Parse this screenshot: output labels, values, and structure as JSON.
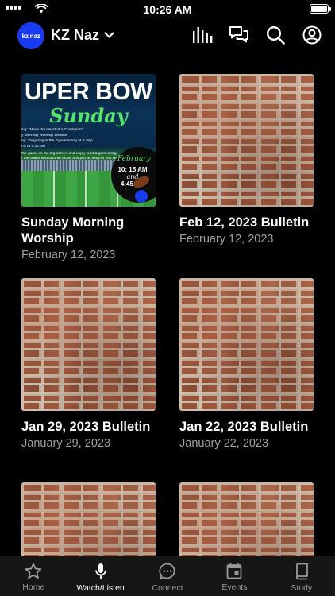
{
  "status": {
    "time": "10:26 AM"
  },
  "header": {
    "org_name": "KZ Naz",
    "avatar_text": "kz naz",
    "icons": [
      "audio-bars-icon",
      "chat-bubbles-icon",
      "search-icon",
      "account-icon"
    ]
  },
  "cards": [
    {
      "title": "Sunday Morning Worship",
      "date": "February 12, 2023",
      "thumb": "super-bowl",
      "art": {
        "line1": "UPER BOW",
        "line2": "Sunday",
        "details": [
          "ing: \"Have the Heart of a Champion\"",
          "y Morning Worship Service",
          "ng: Tailgating in the Gym starting at 4:45 p",
          "l is at 5:30 pm",
          "the game on the big screen and enjoy food & games together",
          "t the chairs and favorite foods and join as long as you like"
        ],
        "circle_date": "February",
        "circle_times": [
          "10: 15 AM",
          "and",
          "4:45 PM"
        ]
      }
    },
    {
      "title": "Feb 12, 2023 Bulletin",
      "date": "February 12, 2023",
      "thumb": "brick"
    },
    {
      "title": "Jan 29, 2023 Bulletin",
      "date": "January 29, 2023",
      "thumb": "brick"
    },
    {
      "title": "Jan 22, 2023 Bulletin",
      "date": "January 22, 2023",
      "thumb": "brick"
    },
    {
      "title": "",
      "date": "",
      "thumb": "brick"
    },
    {
      "title": "",
      "date": "",
      "thumb": "brick"
    }
  ],
  "tabs": [
    {
      "label": "Home",
      "icon": "star-icon",
      "active": false
    },
    {
      "label": "Watch/Listen",
      "icon": "microphone-icon",
      "active": true
    },
    {
      "label": "Connect",
      "icon": "chat-dots-icon",
      "active": false
    },
    {
      "label": "Events",
      "icon": "calendar-icon",
      "active": false
    },
    {
      "label": "Study",
      "icon": "book-icon",
      "active": false
    }
  ]
}
